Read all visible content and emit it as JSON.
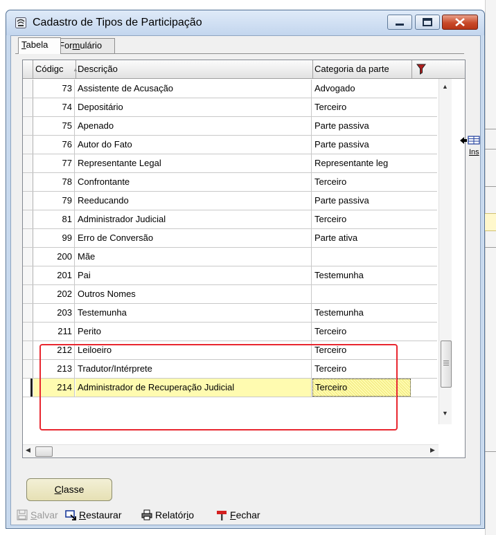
{
  "window": {
    "title": "Cadastro de Tipos de Participação",
    "minimize_icon": "minimize-icon",
    "maximize_icon": "maximize-icon",
    "close_icon": "close-icon"
  },
  "tabs": [
    {
      "label_key": "T",
      "label_rest": "abela",
      "active": true
    },
    {
      "label_pre": "For",
      "label_key": "m",
      "label_rest": "ulário",
      "active": false
    }
  ],
  "grid": {
    "columns": [
      "Códigc",
      "Descrição",
      "Categoria da parte"
    ],
    "rows": [
      {
        "code": "73",
        "desc": "Assistente de Acusação",
        "cat": "Advogado"
      },
      {
        "code": "74",
        "desc": "Depositário",
        "cat": "Terceiro"
      },
      {
        "code": "75",
        "desc": "Apenado",
        "cat": "Parte passiva"
      },
      {
        "code": "76",
        "desc": "Autor do Fato",
        "cat": "Parte passiva"
      },
      {
        "code": "77",
        "desc": "Representante Legal",
        "cat": "Representante leg"
      },
      {
        "code": "78",
        "desc": "Confrontante",
        "cat": "Terceiro"
      },
      {
        "code": "79",
        "desc": "Reeducando",
        "cat": "Parte passiva"
      },
      {
        "code": "81",
        "desc": "Administrador Judicial",
        "cat": "Terceiro"
      },
      {
        "code": "99",
        "desc": "Erro de Conversão",
        "cat": "Parte ativa"
      },
      {
        "code": "200",
        "desc": "Mãe",
        "cat": ""
      },
      {
        "code": "201",
        "desc": "Pai",
        "cat": "Testemunha"
      },
      {
        "code": "202",
        "desc": "Outros Nomes",
        "cat": ""
      },
      {
        "code": "203",
        "desc": "Testemunha",
        "cat": "Testemunha"
      },
      {
        "code": "211",
        "desc": "Perito",
        "cat": "Terceiro"
      },
      {
        "code": "212",
        "desc": "Leiloeiro",
        "cat": "Terceiro"
      },
      {
        "code": "213",
        "desc": "Tradutor/Intérprete",
        "cat": "Terceiro"
      },
      {
        "code": "214",
        "desc": "Administrador de Recuperação Judicial",
        "cat": "Terceiro"
      }
    ],
    "selected_code": "214"
  },
  "side": {
    "ins_label": "Ins"
  },
  "classe_button": {
    "key": "C",
    "rest": "lasse"
  },
  "toolbar": {
    "salvar": {
      "key": "S",
      "rest": "alvar",
      "enabled": false
    },
    "restaurar": {
      "key": "R",
      "rest": "estaurar"
    },
    "relatorio": {
      "pre": "Relatór",
      "key": "i",
      "rest": "o"
    },
    "fechar": {
      "key": "F",
      "rest": "echar"
    }
  },
  "colors": {
    "selected_row": "#fffbb0",
    "highlight_box": "#e8262f",
    "window_frame": "#c7d9ee"
  }
}
